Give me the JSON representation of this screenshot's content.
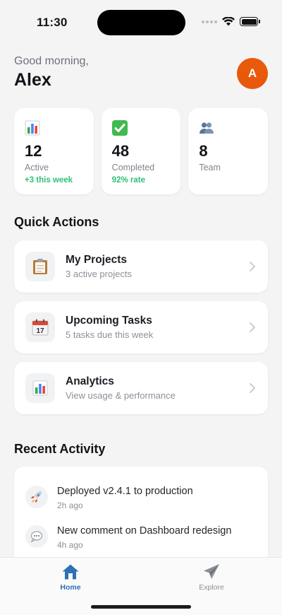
{
  "status_bar": {
    "time": "11:30"
  },
  "header": {
    "greeting": "Good morning,",
    "name": "Alex",
    "avatar_initial": "A",
    "avatar_color": "#e8590c"
  },
  "stats": [
    {
      "icon": "bar-chart-icon",
      "value": "12",
      "label": "Active",
      "trend": "+3 this week"
    },
    {
      "icon": "check-box-icon",
      "value": "48",
      "label": "Completed",
      "trend": "92% rate"
    },
    {
      "icon": "team-icon",
      "value": "8",
      "label": "Team",
      "trend": ""
    }
  ],
  "quick_actions": {
    "title": "Quick Actions",
    "items": [
      {
        "icon": "clipboard-icon",
        "title": "My Projects",
        "subtitle": "3 active projects"
      },
      {
        "icon": "calendar-icon",
        "title": "Upcoming Tasks",
        "subtitle": "5 tasks due this week"
      },
      {
        "icon": "bar-chart-icon",
        "title": "Analytics",
        "subtitle": "View usage & performance"
      }
    ]
  },
  "recent_activity": {
    "title": "Recent Activity",
    "items": [
      {
        "icon": "rocket-icon",
        "text": "Deployed v2.4.1 to production",
        "time": "2h ago"
      },
      {
        "icon": "speech-bubble-icon",
        "text": "New comment on Dashboard redesign",
        "time": "4h ago"
      }
    ]
  },
  "tabbar": {
    "tabs": [
      {
        "icon": "home-icon",
        "label": "Home",
        "active": true
      },
      {
        "icon": "paper-plane-icon",
        "label": "Explore",
        "active": false
      }
    ]
  },
  "colors": {
    "accent": "#2f6fb5",
    "trend_green": "#2fbf77",
    "background": "#f4f4f5"
  }
}
